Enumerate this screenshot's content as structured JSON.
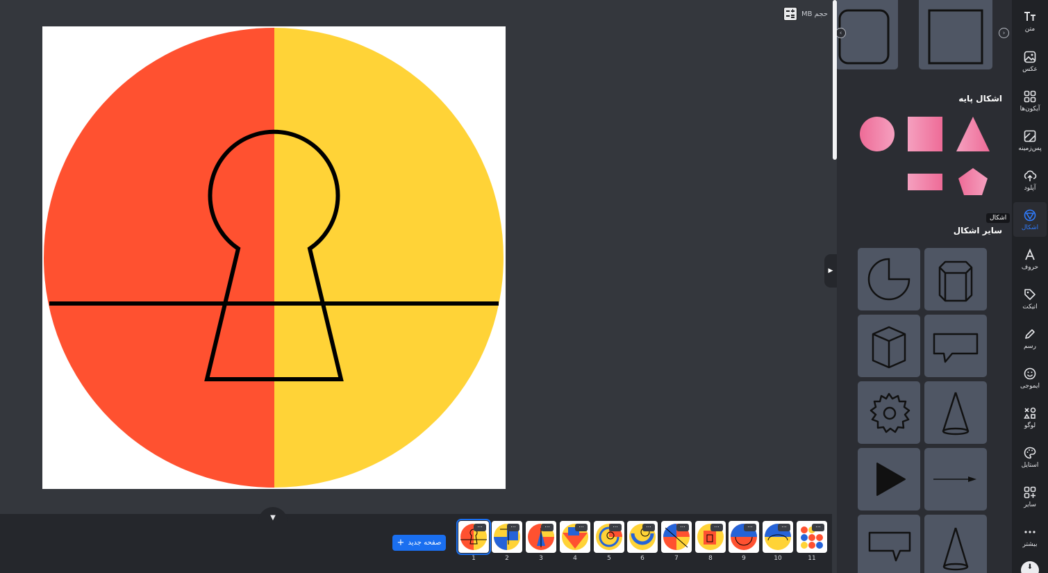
{
  "app": {
    "accent_color": "#1a6ff0"
  },
  "canvas": {
    "size_label": "حجم MB",
    "size_icon": "calculator-icon",
    "design_colors": {
      "left_half": "#ff5130",
      "right_half": "#ffd337",
      "stroke": "#000000",
      "background": "#ffffff"
    }
  },
  "pages": {
    "new_page_label": "صفحه جدید",
    "new_page_icon": "plus-icon",
    "collapse_icon": "chevron-down-icon",
    "more_label": "...",
    "items": [
      {
        "number": "1",
        "active": true
      },
      {
        "number": "2",
        "active": false
      },
      {
        "number": "3",
        "active": false
      },
      {
        "number": "4",
        "active": false
      },
      {
        "number": "5",
        "active": false
      },
      {
        "number": "6",
        "active": false
      },
      {
        "number": "7",
        "active": false
      },
      {
        "number": "8",
        "active": false
      },
      {
        "number": "9",
        "active": false
      },
      {
        "number": "10",
        "active": false
      },
      {
        "number": "11",
        "active": false
      }
    ]
  },
  "shapes_panel": {
    "basic_shapes_title": "اشکال پایه",
    "other_shapes_title": "سایر اشکال",
    "tooltip": "اشکال",
    "basic_shapes": [
      "circle",
      "square",
      "triangle",
      "rectangle",
      "pentagon"
    ],
    "basic_shape_color": "#f07aa0",
    "other_shapes": [
      "pie-chart",
      "hexagonal-prism",
      "cube",
      "speech-bubble",
      "gear",
      "cone",
      "play-triangle",
      "arrow",
      "speech-bubble-2",
      "cone-2"
    ],
    "carousel": [
      "rounded-square-outline",
      "square-outline"
    ]
  },
  "rail": {
    "items": [
      {
        "label": "متن",
        "icon": "text-icon",
        "active": false
      },
      {
        "label": "عکس",
        "icon": "photo-icon",
        "active": false
      },
      {
        "label": "آیکون‌ها",
        "icon": "icons-grid-icon",
        "active": false
      },
      {
        "label": "پس‌زمینه",
        "icon": "background-icon",
        "active": false
      },
      {
        "label": "آپلود",
        "icon": "upload-icon",
        "active": false
      },
      {
        "label": "اشکال",
        "icon": "shapes-icon",
        "active": true
      },
      {
        "label": "حروف",
        "icon": "letter-icon",
        "active": false
      },
      {
        "label": "اتیکت",
        "icon": "tag-icon",
        "active": false
      },
      {
        "label": "رسم",
        "icon": "pencil-icon",
        "active": false
      },
      {
        "label": "ایموجی",
        "icon": "emoji-icon",
        "active": false
      },
      {
        "label": "لوگو",
        "icon": "logo-icon",
        "active": false
      },
      {
        "label": "استایل",
        "icon": "palette-icon",
        "active": false
      },
      {
        "label": "سایر",
        "icon": "apps-plus-icon",
        "active": false
      },
      {
        "label": "بیشتر",
        "icon": "more-dots-icon",
        "active": false
      }
    ]
  }
}
